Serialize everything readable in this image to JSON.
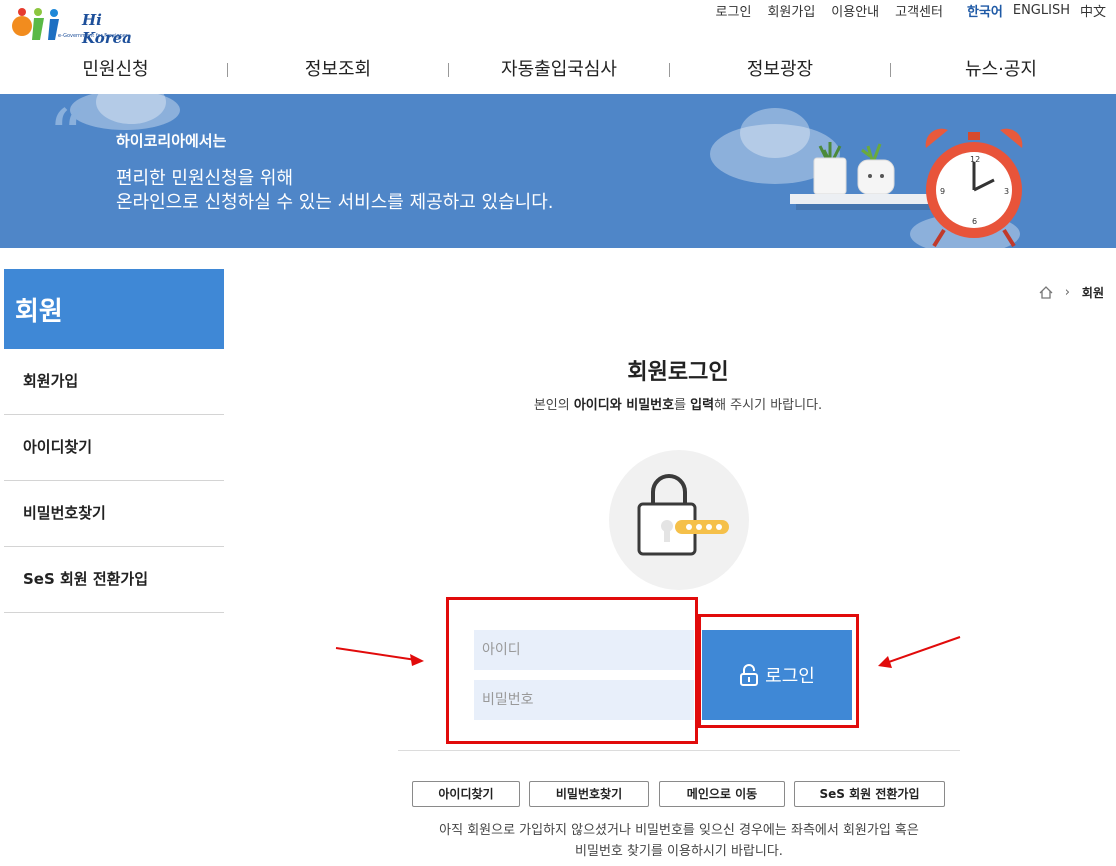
{
  "logo": {
    "text": "Hi Korea",
    "sub": "e-Government for Foreigners"
  },
  "util_links": [
    "로그인",
    "회원가입",
    "이용안내",
    "고객센터"
  ],
  "languages": [
    {
      "label": "한국어",
      "active": true
    },
    {
      "label": "ENGLISH",
      "active": false
    },
    {
      "label": "中文",
      "active": false
    }
  ],
  "nav": [
    "민원신청",
    "정보조회",
    "자동출입국심사",
    "정보광장",
    "뉴스·공지"
  ],
  "banner": {
    "line1": "하이코리아에서는",
    "line2": "편리한 민원신청을 위해",
    "line3": "온라인으로 신청하실 수 있는 서비스를 제공하고 있습니다."
  },
  "sidebar": {
    "title": "회원",
    "items": [
      "회원가입",
      "아이디찾기",
      "비밀번호찾기",
      "SeS 회원 전환가입"
    ]
  },
  "breadcrumb": {
    "current": "회원"
  },
  "main": {
    "title": "회원로그인",
    "desc_pre": "본인의 ",
    "desc_b1": "아이디",
    "desc_mid1": "와 ",
    "desc_b2": "비밀번호",
    "desc_mid2": "를 ",
    "desc_b3": "입력",
    "desc_post": "해 주시기 바랍니다."
  },
  "form": {
    "id_placeholder": "아이디",
    "pw_placeholder": "비밀번호",
    "login_label": "로그인"
  },
  "bottom_buttons": [
    "아이디찾기",
    "비밀번호찾기",
    "메인으로 이동",
    "SeS 회원 전환가입"
  ],
  "notice": {
    "line1": "아직 회원으로 가입하지 않으셨거나 비밀번호를 잊으신 경우에는 좌측에서 회원가입 혹은",
    "line2": "비밀번호 찾기를 이용하시기 바랍니다."
  },
  "colors": {
    "accent": "#3f88d6",
    "banner": "#4f86c8",
    "annotation": "#e10b0b"
  }
}
